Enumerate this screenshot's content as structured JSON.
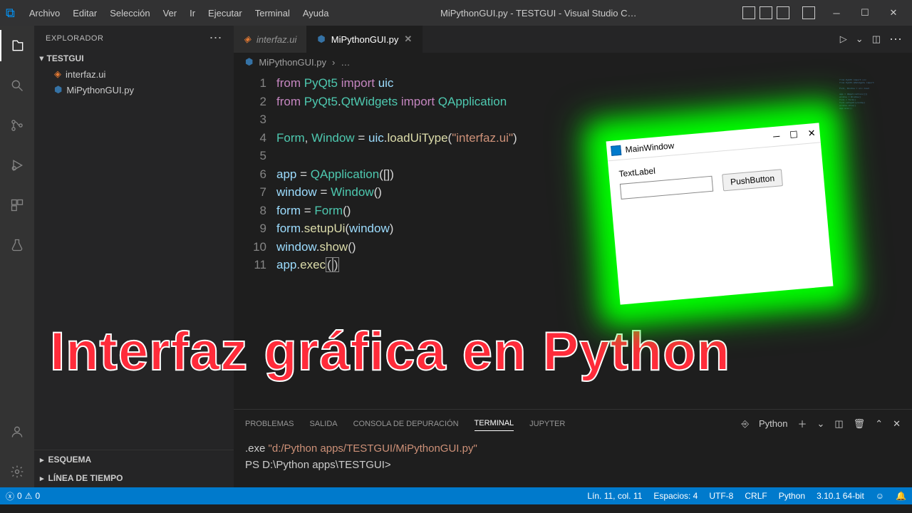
{
  "title": "MiPythonGUI.py - TESTGUI - Visual Studio C…",
  "menu": [
    "Archivo",
    "Editar",
    "Selección",
    "Ver",
    "Ir",
    "Ejecutar",
    "Terminal",
    "Ayuda"
  ],
  "sidebar": {
    "header": "EXPLORADOR",
    "folder": "TESTGUI",
    "files": [
      {
        "name": "interfaz.ui",
        "icon": "ui"
      },
      {
        "name": "MiPythonGUI.py",
        "icon": "py"
      }
    ],
    "outline": "ESQUEMA",
    "timeline": "LÍNEA DE TIEMPO"
  },
  "tabs": [
    {
      "label": "interfaz.ui",
      "active": false,
      "icon": "ui"
    },
    {
      "label": "MiPythonGUI.py",
      "active": true,
      "icon": "py"
    }
  ],
  "breadcrumb": {
    "file": "MiPythonGUI.py",
    "rest": "…"
  },
  "code": {
    "lines": [
      "1",
      "2",
      "3",
      "4",
      "5",
      "6",
      "7",
      "8",
      "9",
      "10",
      "11"
    ]
  },
  "panel": {
    "tabs": [
      "PROBLEMAS",
      "SALIDA",
      "CONSOLA DE DEPURACIÓN",
      "TERMINAL",
      "JUPYTER"
    ],
    "active": 3,
    "kernel": "Python",
    "term_path": "\"d:/Python apps/TESTGUI/MiPythonGUI.py\"",
    "term_exe": ".exe ",
    "prompt": "PS D:\\Python apps\\TESTGUI>"
  },
  "status": {
    "errors": "0",
    "warnings": "0",
    "ln": "Lín. 11, col. 11",
    "spaces": "Espacios: 4",
    "enc": "UTF-8",
    "eol": "CRLF",
    "lang": "Python",
    "interp": "3.10.1 64-bit"
  },
  "overlay": "Interfaz gráfica en Python",
  "floatwin": {
    "title": "MainWindow",
    "label": "TextLabel",
    "button": "PushButton"
  }
}
